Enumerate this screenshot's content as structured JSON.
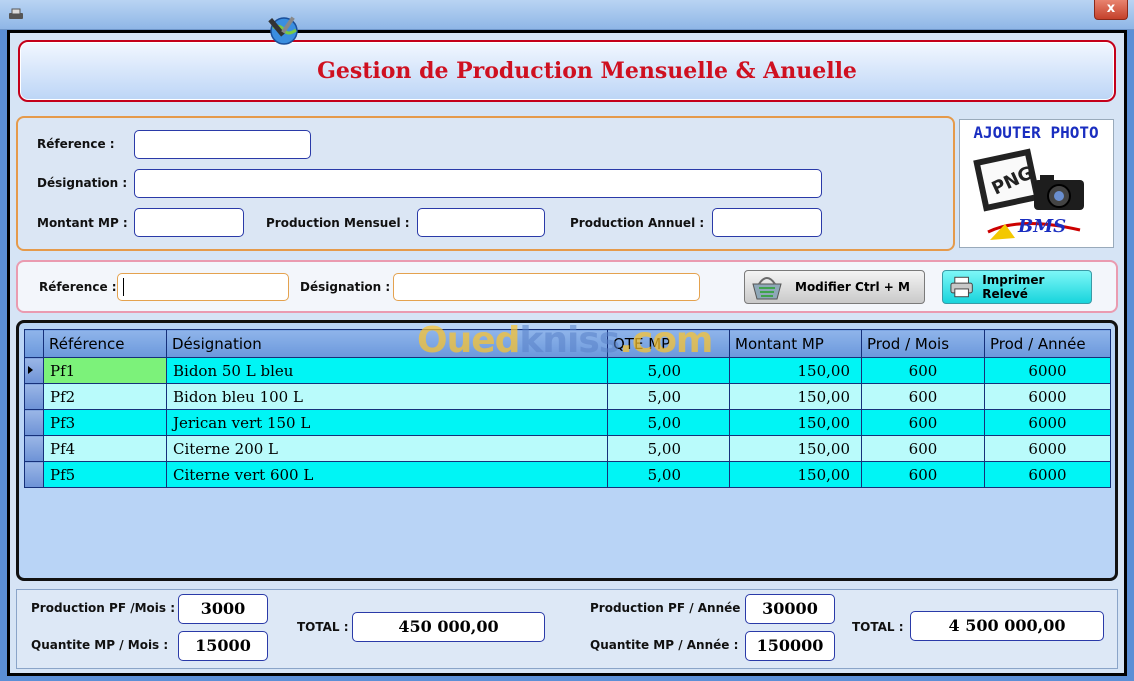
{
  "window": {
    "close_label": "x"
  },
  "header": {
    "title": "Gestion de Production Mensuelle & Anuelle"
  },
  "form": {
    "reference_label": "Réference :",
    "reference_value": "",
    "designation_label": "Désignation :",
    "designation_value": "",
    "montant_label": "Montant MP :",
    "montant_value": "",
    "prod_mensuel_label": "Production Mensuel :",
    "prod_mensuel_value": "",
    "prod_annuel_label": "Production Annuel :",
    "prod_annuel_value": ""
  },
  "photo": {
    "title": "AJOUTER PHOTO",
    "png_text": "PNG",
    "logo_text": "BMS"
  },
  "search": {
    "reference_label": "Réference :",
    "designation_label": "Désignation :",
    "modifier_label": "Modifier  Ctrl + M",
    "imprimer_label": "Imprimer Relevé"
  },
  "watermark": {
    "part1": "Oued",
    "part2": "kniss",
    "part3": ".com"
  },
  "table": {
    "columns": [
      "Référence",
      "Désignation",
      "QTE MP",
      "Montant MP",
      "Prod / Mois",
      "Prod / Année"
    ],
    "rows": [
      [
        "Pf1",
        "Bidon 50 L bleu",
        "5,00",
        "150,00",
        "600",
        "6000"
      ],
      [
        "Pf2",
        "Bidon bleu 100 L",
        "5,00",
        "150,00",
        "600",
        "6000"
      ],
      [
        "Pf3",
        "Jerican vert 150 L",
        "5,00",
        "150,00",
        "600",
        "6000"
      ],
      [
        "Pf4",
        "Citerne 200 L",
        "5,00",
        "150,00",
        "600",
        "6000"
      ],
      [
        "Pf5",
        "Citerne vert 600 L",
        "5,00",
        "150,00",
        "600",
        "6000"
      ]
    ]
  },
  "footer": {
    "prod_pf_mois_label": "Production PF /Mois :",
    "prod_pf_mois_value": "3000",
    "qte_mp_mois_label": "Quantite  MP  / Mois :",
    "qte_mp_mois_value": "15000",
    "total_label_1": "TOTAL :",
    "total_value_1": "450 000,00",
    "prod_pf_annee_label": "Production PF / Année :",
    "prod_pf_annee_value": "30000",
    "qte_mp_annee_label": "Quantite  MP  / Année :",
    "qte_mp_annee_value": "150000",
    "total_label_2": "TOTAL :",
    "total_value_2": "4 500 000,00"
  }
}
